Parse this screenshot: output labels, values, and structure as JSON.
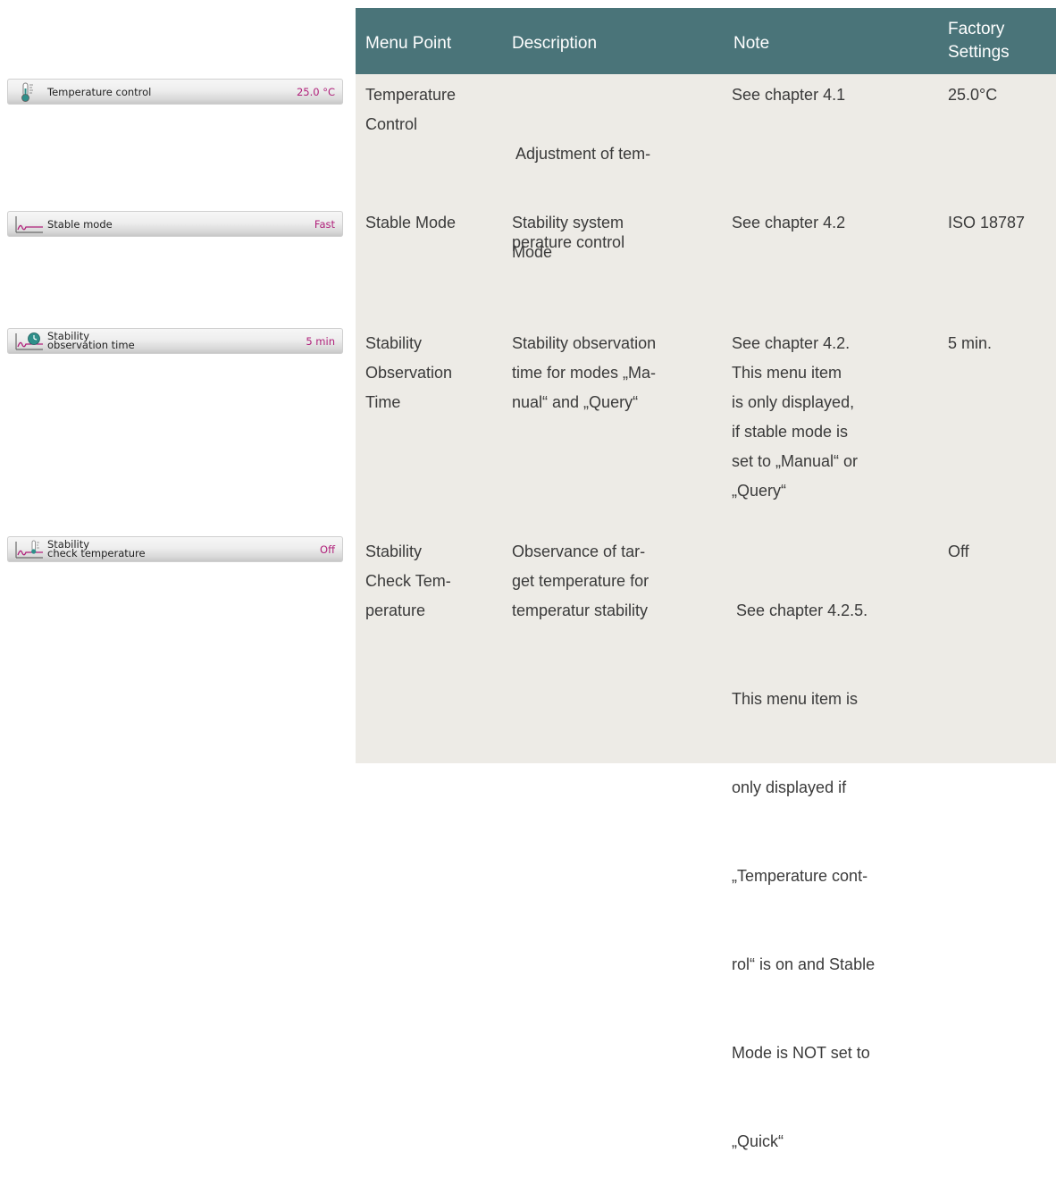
{
  "table": {
    "headers": {
      "menu_point": "Menu Point",
      "description": "Description",
      "note": "Note",
      "factory_line1": "Factory",
      "factory_line2": "Settings"
    },
    "rows": [
      {
        "menu_point": [
          "Temperature",
          "Control"
        ],
        "description": [
          " Adjustment of tem-",
          "perature control"
        ],
        "note": [
          "See chapter 4.1"
        ],
        "factory": "25.0°C"
      },
      {
        "menu_point": [
          "Stable Mode"
        ],
        "description": [
          "Stability system",
          "Mode"
        ],
        "note": [
          "See chapter 4.2"
        ],
        "factory": "ISO 18787"
      },
      {
        "menu_point": [
          "Stability",
          "Observation",
          "Time"
        ],
        "description": [
          "Stability observation",
          "time for modes „Ma-",
          "nual“ and „Query“"
        ],
        "note": [
          "See chapter 4.2.",
          "This menu item",
          "is only displayed,",
          "if stable mode is",
          "set to „Manual“ or",
          "„Query“"
        ],
        "factory": "5 min."
      },
      {
        "menu_point": [
          "Stability",
          "Check Tem-",
          "perature"
        ],
        "description": [
          "Observance of tar-",
          "get temperature for",
          "temperatur stability"
        ],
        "note": [
          " See chapter 4.2.5.",
          "This menu item is",
          "only displayed if",
          "„Temperature cont-",
          "rol“ is on and Stable",
          "Mode is NOT set to",
          "„Quick“"
        ],
        "factory": "Off"
      }
    ]
  },
  "screens": [
    {
      "label": [
        "Temperature control"
      ],
      "value": "25.0 °C",
      "icon": "thermometer-icon"
    },
    {
      "label": [
        "Stable mode"
      ],
      "value": "Fast",
      "icon": "stability-curve-icon"
    },
    {
      "label": [
        "Stability",
        "observation time"
      ],
      "value": "5 min",
      "icon": "stability-clock-icon"
    },
    {
      "label": [
        "Stability",
        "check temperature"
      ],
      "value": "Off",
      "icon": "stability-thermometer-icon"
    }
  ],
  "colors": {
    "header_bg": "#4a7479",
    "table_bg": "#edebe6",
    "value_text": "#b0207a",
    "icon_accent": "#2f8f8a"
  }
}
